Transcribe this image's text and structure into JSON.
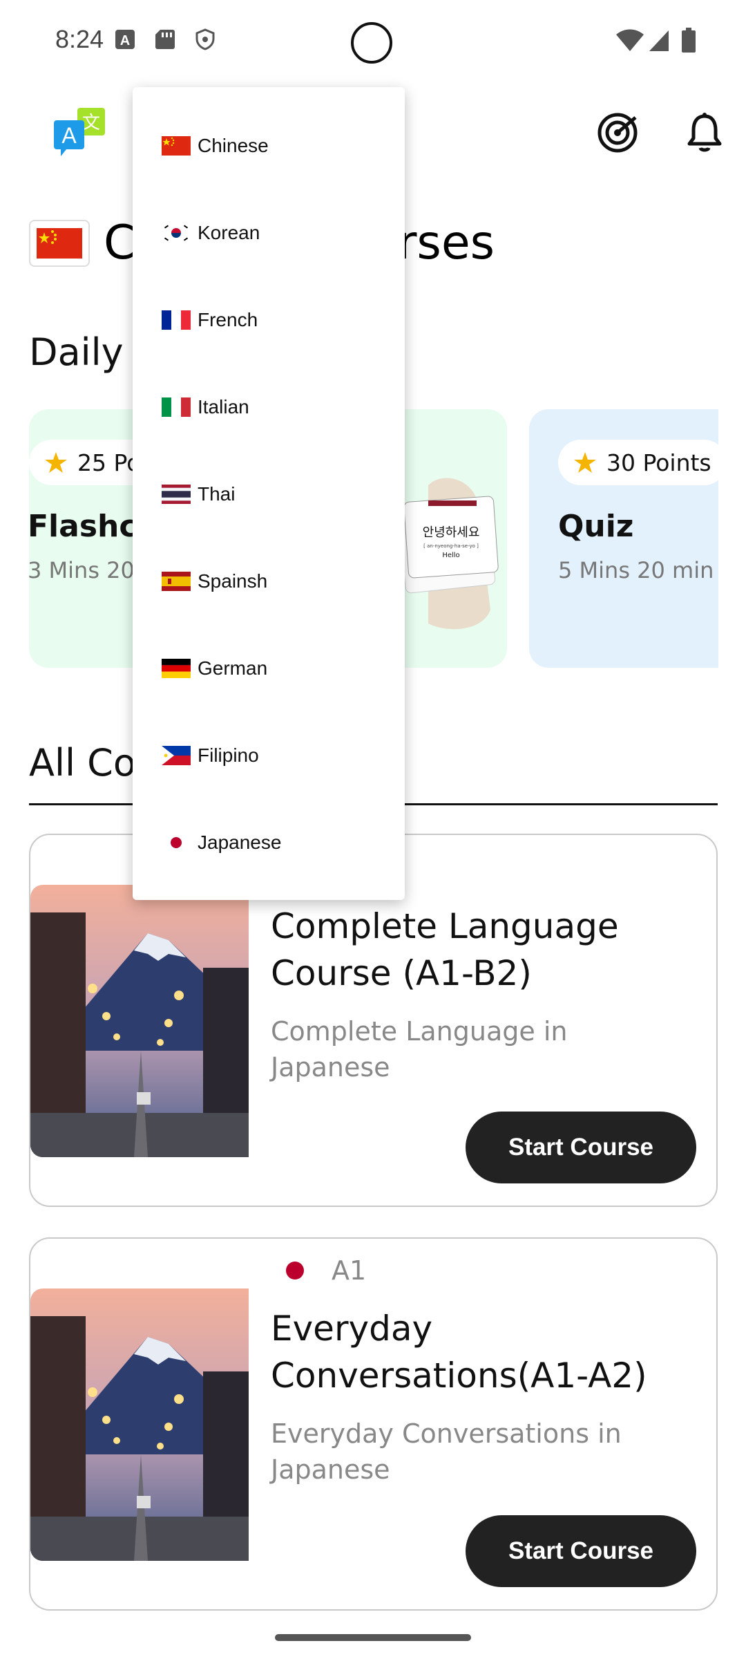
{
  "status_bar": {
    "time": "8:24"
  },
  "page": {
    "title": "Chinese Courses"
  },
  "daily": {
    "section_title": "Daily",
    "cards": [
      {
        "points": "25 Points",
        "title": "Flashcards",
        "duration": "3 Mins 20 min"
      },
      {
        "points": "",
        "title": "",
        "duration": ""
      },
      {
        "points": "30 Points",
        "title": "Quiz",
        "duration": "5 Mins 20 min"
      }
    ]
  },
  "all_courses": {
    "section_title": "All Courses",
    "courses": [
      {
        "level": "",
        "title": "Complete Language Course (A1-B2)",
        "description": "Complete Language in Japanese",
        "button": "Start Course"
      },
      {
        "level": "A1",
        "title": "Everyday Conversations(A1-A2)",
        "description": "Everyday Conversations in Japanese",
        "button": "Start Course"
      }
    ]
  },
  "flashcard_image": {
    "line1": "안녕하세요",
    "line2": "[ an-nyeong-ha-se-yo ]",
    "line3": "Hello"
  },
  "language_menu": {
    "items": [
      {
        "label": "Chinese",
        "flag": "cn-flag-icon"
      },
      {
        "label": "Korean",
        "flag": "kr-flag-icon"
      },
      {
        "label": "French",
        "flag": "fr-flag-icon"
      },
      {
        "label": "Italian",
        "flag": "it-flag-icon"
      },
      {
        "label": "Thai",
        "flag": "th-flag-icon"
      },
      {
        "label": "Spainsh",
        "flag": "es-flag-icon"
      },
      {
        "label": "German",
        "flag": "de-flag-icon"
      },
      {
        "label": "Filipino",
        "flag": "ph-flag-icon"
      },
      {
        "label": "Japanese",
        "flag": "jp-flag-icon"
      }
    ]
  },
  "colors": {
    "flashcard_bg": "#e8fdf0",
    "quiz_bg": "#e3f1fd",
    "button_bg": "#222222",
    "star": "#f4b400"
  }
}
